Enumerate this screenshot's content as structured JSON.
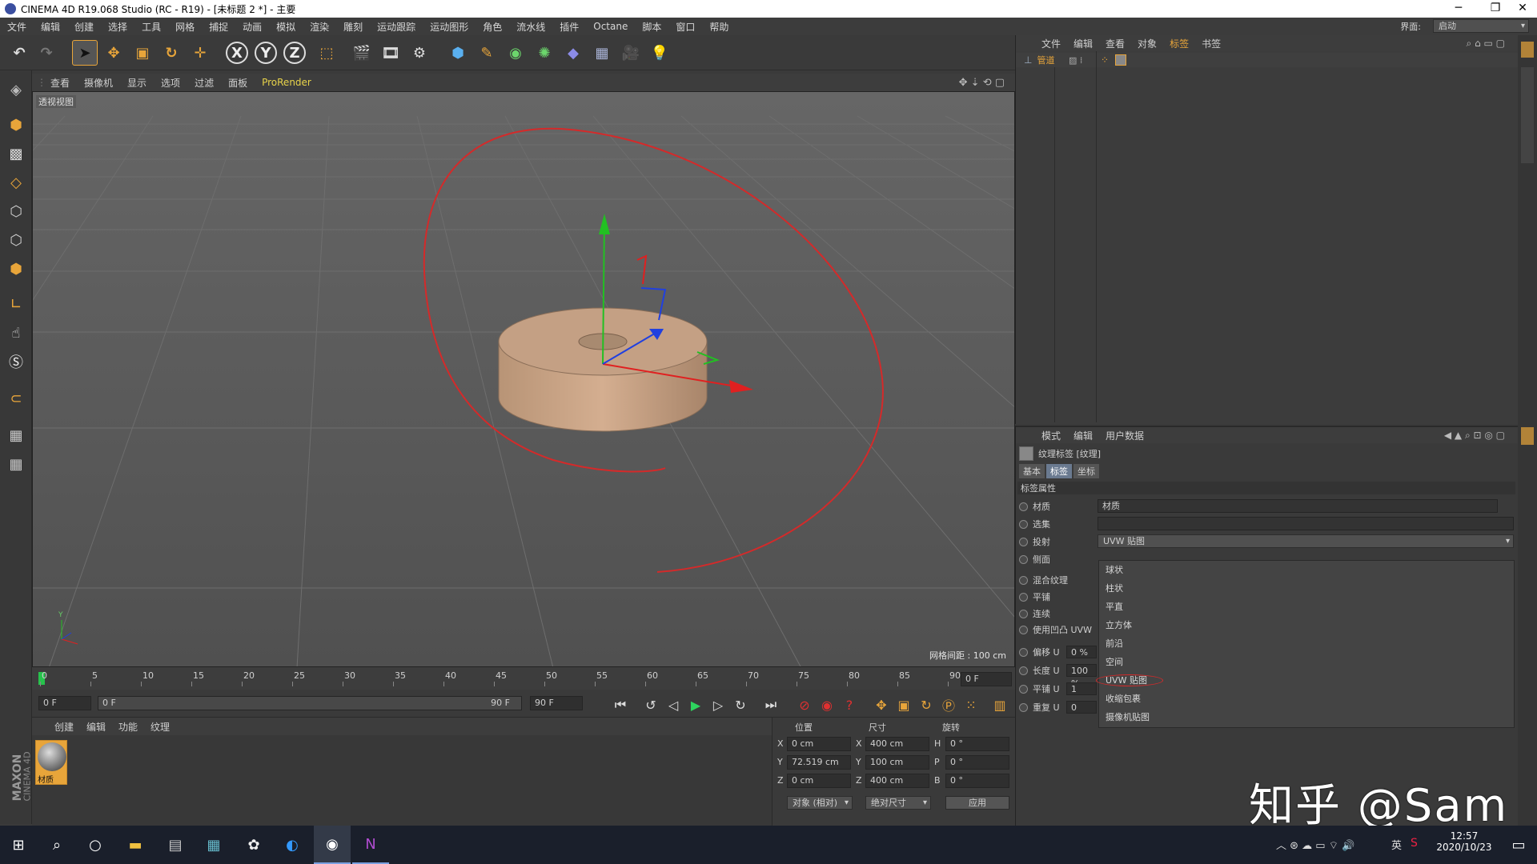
{
  "window": {
    "title": "CINEMA 4D R19.068 Studio (RC - R19) - [未标题 2 *] - 主要",
    "min": "─",
    "max": "❐",
    "close": "✕"
  },
  "menubar": {
    "items": [
      "文件",
      "编辑",
      "创建",
      "选择",
      "工具",
      "网格",
      "捕捉",
      "动画",
      "模拟",
      "渲染",
      "雕刻",
      "运动跟踪",
      "运动图形",
      "角色",
      "流水线",
      "插件",
      "Octane",
      "脚本",
      "窗口",
      "帮助"
    ],
    "layout_label": "界面:",
    "layout_value": "启动"
  },
  "viewport": {
    "menu": [
      "查看",
      "摄像机",
      "显示",
      "选项",
      "过滤",
      "面板",
      "ProRender"
    ],
    "label": "透视视图",
    "grid_info": "网格间距 : 100 cm"
  },
  "timeline": {
    "ticks": [
      "0",
      "5",
      "10",
      "15",
      "20",
      "25",
      "30",
      "35",
      "40",
      "45",
      "50",
      "55",
      "60",
      "65",
      "70",
      "75",
      "80",
      "85",
      "90"
    ],
    "current_frame": "0 F",
    "start_field": "0 F",
    "range_start": "0 F",
    "range_end": "90 F",
    "end_field": "90 F"
  },
  "material_panel": {
    "menu": [
      "创建",
      "编辑",
      "功能",
      "纹理"
    ],
    "material_name": "材质",
    "brand_maxon": "MAXON",
    "brand_c4d": "CINEMA 4D"
  },
  "coords": {
    "headers": [
      "位置",
      "尺寸",
      "旋转"
    ],
    "rows": [
      {
        "axis": "X",
        "pos": "0 cm",
        "size_axis": "X",
        "size": "400 cm",
        "rot_axis": "H",
        "rot": "0 °"
      },
      {
        "axis": "Y",
        "pos": "72.519 cm",
        "size_axis": "Y",
        "size": "100 cm",
        "rot_axis": "P",
        "rot": "0 °"
      },
      {
        "axis": "Z",
        "pos": "0 cm",
        "size_axis": "Z",
        "size": "400 cm",
        "rot_axis": "B",
        "rot": "0 °"
      }
    ],
    "mode_dropdown": "对象 (相对)",
    "size_dropdown": "绝对尺寸",
    "apply": "应用"
  },
  "object_manager": {
    "menu": [
      "文件",
      "编辑",
      "查看",
      "对象",
      "标签",
      "书签"
    ],
    "object_name": "管道"
  },
  "attributes": {
    "menu": [
      "模式",
      "编辑",
      "用户数据"
    ],
    "header": "纹理标签 [纹理]",
    "tabs": [
      "基本",
      "标签",
      "坐标"
    ],
    "section": "标签属性",
    "rows": [
      {
        "label": "材质",
        "value": "材质"
      },
      {
        "label": "选集",
        "value": ""
      },
      {
        "label": "投射",
        "value": "UVW 贴图"
      },
      {
        "label": "侧面",
        "value": ""
      },
      {
        "label": "混合纹理",
        "value": ""
      },
      {
        "label": "平铺",
        "value": ""
      },
      {
        "label": "连续",
        "value": ""
      },
      {
        "label": "使用凹凸 UVW",
        "value": ""
      },
      {
        "label": "偏移 U",
        "value": "0 %"
      },
      {
        "label": "长度 U",
        "value": "100 %"
      },
      {
        "label": "平铺 U",
        "value": "1"
      },
      {
        "label": "重复 U",
        "value": "0"
      }
    ],
    "dropdown_options": [
      "球状",
      "柱状",
      "平直",
      "立方体",
      "前沿",
      "空间",
      "UVW 贴图",
      "收缩包裹",
      "摄像机贴图"
    ]
  },
  "taskbar": {
    "time": "12:57",
    "date": "2020/10/23",
    "ime": "英"
  },
  "watermark": "知乎 @Sam",
  "colors": {
    "accent_orange": "#e8a53a",
    "x_axis": "#e02020",
    "y_axis": "#22c022",
    "z_axis": "#2040e0",
    "spline": "#d42a2a",
    "pipe": "#c9a488"
  }
}
